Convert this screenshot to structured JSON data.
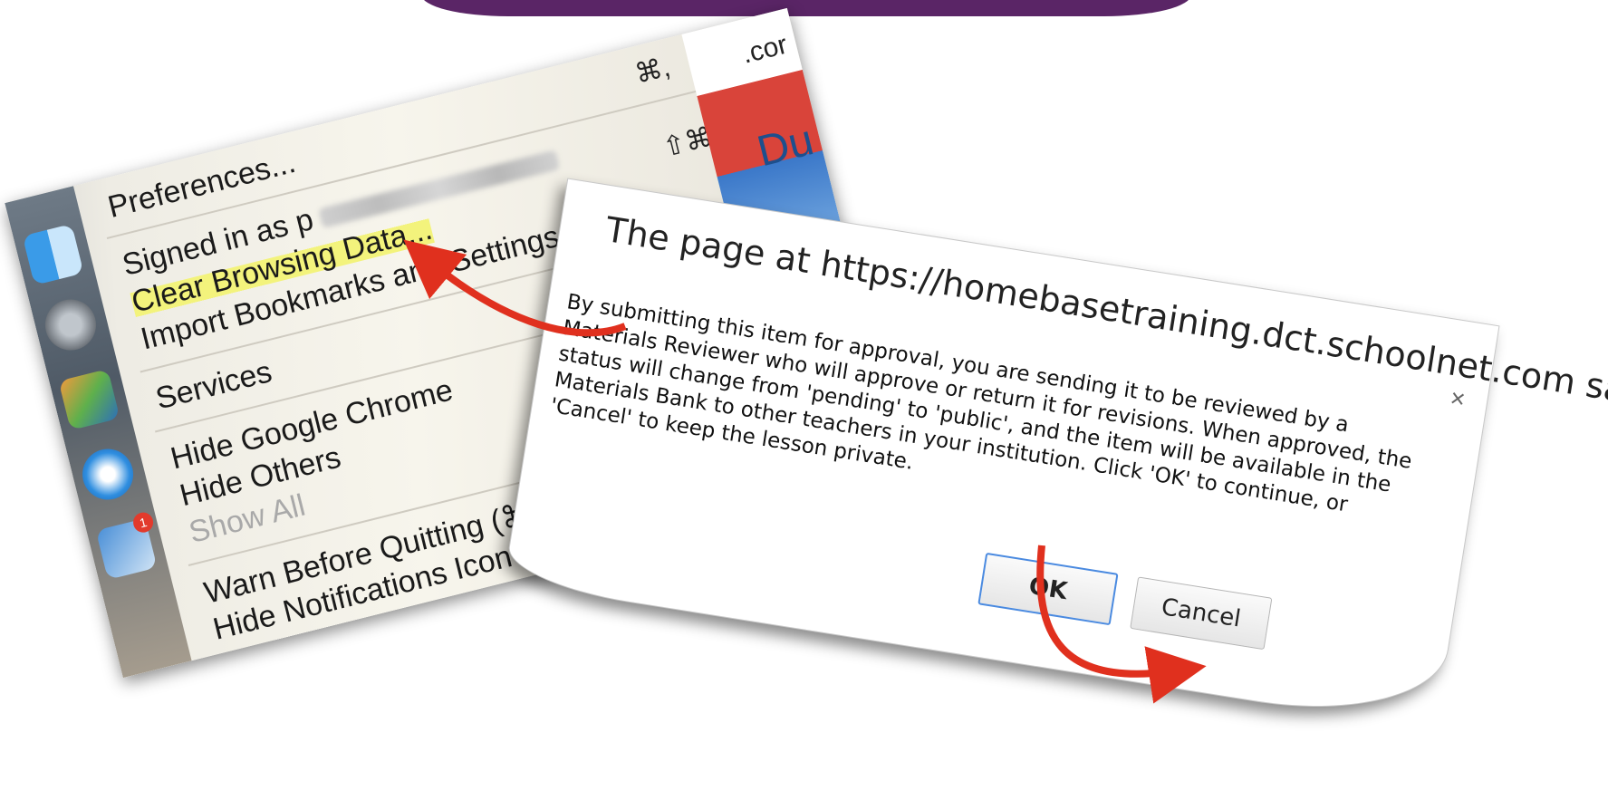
{
  "app_menu": {
    "items": [
      {
        "label": "Preferences...",
        "shortcut": "⌘,"
      },
      {
        "label": "Signed in as p"
      },
      {
        "label": "Clear Browsing Data...",
        "shortcut": "⇧⌘⌫",
        "highlighted": true
      },
      {
        "label": "Import Bookmarks and Settings..."
      },
      {
        "label": "Services"
      },
      {
        "label": "Hide Google Chrome"
      },
      {
        "label": "Hide Others"
      },
      {
        "label": "Show All",
        "disabled": true
      },
      {
        "label": "Warn Before Quitting (⌘Q)"
      },
      {
        "label": "Hide Notifications Icon"
      }
    ],
    "browser_fragment": ".cor",
    "browser_fragment_2": "Du",
    "dock_badge": "1"
  },
  "dialog": {
    "title": "The page at https://homebasetraining.dct.schoolnet.com says:",
    "message": "By submitting this item for approval, you are sending it to be reviewed by a Materials Reviewer who will approve or return it for revisions. When approved, the status will change from 'pending' to 'public', and the item will be available in the Materials Bank to other teachers in your institution. Click 'OK' to continue, or 'Cancel' to keep the lesson private.",
    "ok_label": "OK",
    "cancel_label": "Cancel",
    "close_icon": "×"
  },
  "colors": {
    "arrow": "#e0301e",
    "highlight": "#f3f37c",
    "banner": "#5a2566",
    "ok_focus": "#4a8ae0"
  }
}
